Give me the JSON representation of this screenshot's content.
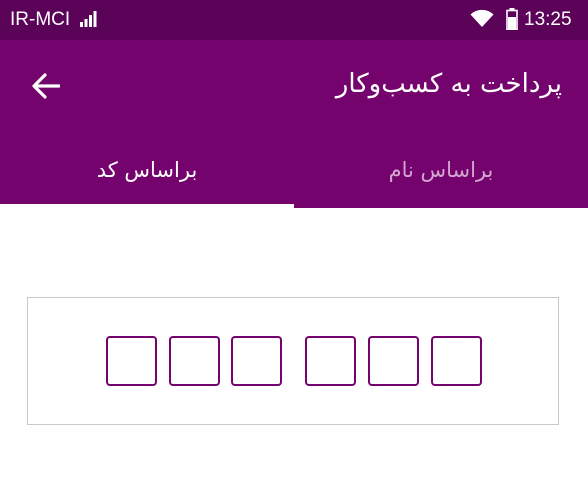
{
  "status_bar": {
    "carrier": "IR-MCI",
    "time": "13:25",
    "icons": [
      "signal-icon",
      "wifi-icon",
      "battery-icon"
    ]
  },
  "app_bar": {
    "title": "پرداخت به کسب‌وکار",
    "back_icon": "arrow-left-icon",
    "background": "#74036e"
  },
  "tabs": [
    {
      "label": "براساس نام",
      "selected": false
    },
    {
      "label": "براساس کد",
      "selected": true
    }
  ],
  "code_input": {
    "digits": [
      "",
      "",
      "",
      "",
      "",
      ""
    ],
    "accent": "#74036e"
  },
  "colors": {
    "status_bar": "#5b0358",
    "primary": "#74036e",
    "tab_inactive": "#d3a5d0"
  }
}
